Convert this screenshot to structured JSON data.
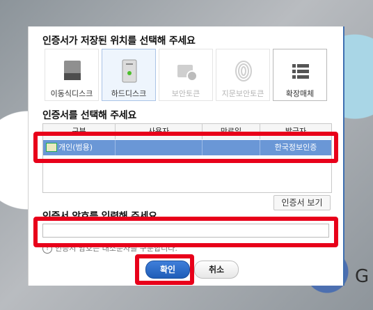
{
  "storage": {
    "title": "인증서가 저장된 위치를 선택해 주세요",
    "tiles": [
      {
        "label": "이동식디스크",
        "icon": "usb-drive-icon",
        "state": "normal"
      },
      {
        "label": "하드디스크",
        "icon": "hard-disk-icon",
        "state": "selected"
      },
      {
        "label": "보안토큰",
        "icon": "security-token-icon",
        "state": "disabled"
      },
      {
        "label": "지문보안토큰",
        "icon": "fingerprint-icon",
        "state": "disabled"
      },
      {
        "label": "확장매체",
        "icon": "extended-media-icon",
        "state": "normal"
      }
    ]
  },
  "certificate": {
    "title": "인증서를 선택해 주세요",
    "columns": [
      "구분",
      "사용자",
      "만료일",
      "발급자"
    ],
    "rows": [
      {
        "type": "개인(범용)",
        "user": "",
        "expiry": "",
        "issuer": "한국정보인증",
        "selected": true
      }
    ],
    "view_button": "인증서 보기"
  },
  "password": {
    "title": "인증서 암호를 입력해 주세요",
    "value": "",
    "notice": "인증서 암호는 대소문자를 구분합니다."
  },
  "buttons": {
    "ok": "확인",
    "cancel": "취소"
  },
  "colors": {
    "selection": "#6a97d6",
    "primary_button": "#2a6cc8",
    "highlight": "#e8001a"
  }
}
